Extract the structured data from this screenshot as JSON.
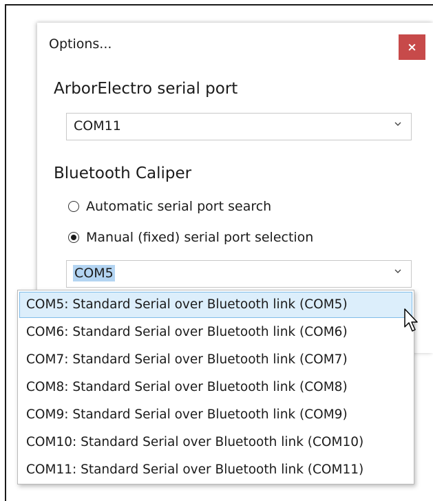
{
  "dialog": {
    "title": "Options...",
    "close_label": "×"
  },
  "arbor": {
    "group_title": "ArborElectro serial port",
    "selected_port": "COM11"
  },
  "caliper": {
    "group_title": "Bluetooth Caliper",
    "radio_auto_label": "Automatic serial port search",
    "radio_manual_label": "Manual (fixed) serial port selection",
    "selected_mode": "manual",
    "selected_port": "COM5"
  },
  "dropdown": {
    "items": [
      {
        "label": "COM5: Standard Serial over Bluetooth link (COM5)"
      },
      {
        "label": "COM6: Standard Serial over Bluetooth link (COM6)"
      },
      {
        "label": "COM7: Standard Serial over Bluetooth link (COM7)"
      },
      {
        "label": "COM8: Standard Serial over Bluetooth link (COM8)"
      },
      {
        "label": "COM9: Standard Serial over Bluetooth link (COM9)"
      },
      {
        "label": "COM10: Standard Serial over Bluetooth link (COM10)"
      },
      {
        "label": "COM11: Standard Serial over Bluetooth link (COM11)"
      }
    ],
    "highlighted_index": 0
  },
  "colors": {
    "close_button": "#c74a4a",
    "selection_highlight": "#b3d4f2",
    "item_hover_bg": "#dceefb",
    "item_hover_border": "#7fbce8"
  },
  "icons": {
    "chevron": "chevron-down-icon",
    "cursor": "mouse-pointer-icon"
  }
}
